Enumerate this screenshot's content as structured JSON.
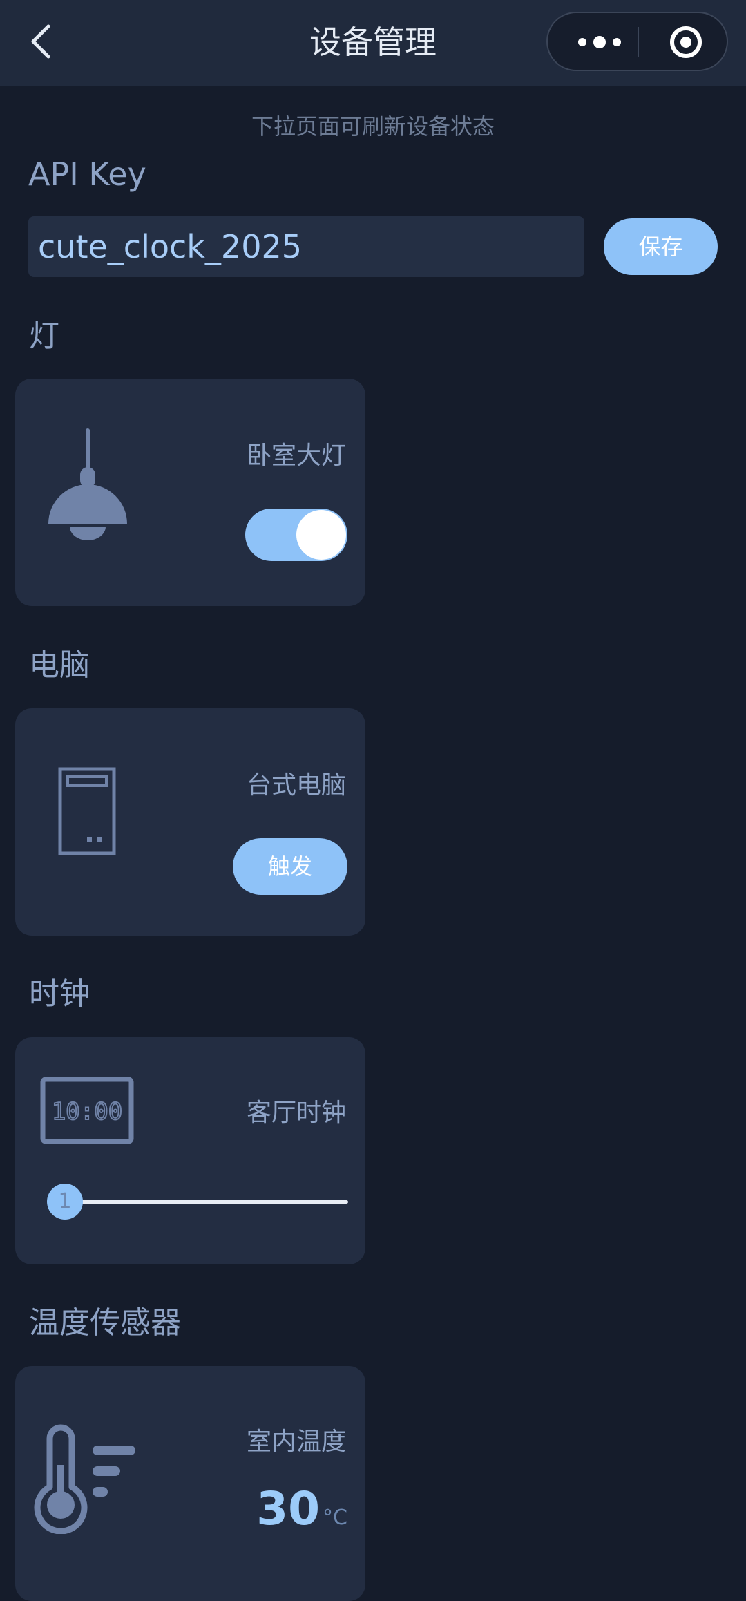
{
  "nav": {
    "title": "设备管理"
  },
  "hint": "下拉页面可刷新设备状态",
  "api_key": {
    "label": "API Key",
    "value": "cute_clock_2025",
    "save_label": "保存"
  },
  "sections": {
    "light": {
      "title": "灯",
      "device_name": "卧室大灯",
      "icon": "pendant-lamp-icon",
      "switch_on": true
    },
    "computer": {
      "title": "电脑",
      "device_name": "台式电脑",
      "icon": "desktop-tower-icon",
      "trigger_label": "触发"
    },
    "clock": {
      "title": "时钟",
      "device_name": "客厅时钟",
      "icon": "digital-clock-icon",
      "icon_text": "10:00",
      "slider_value": "1"
    },
    "temperature": {
      "title": "温度传感器",
      "device_name": "室内温度",
      "icon": "thermometer-icon",
      "value": "30",
      "unit": "°C"
    }
  },
  "colors": {
    "background": "#151c2b",
    "navbar": "#202a3d",
    "card": "#232d42",
    "accent": "#8ec2f8",
    "text": "#8ea3c6"
  }
}
